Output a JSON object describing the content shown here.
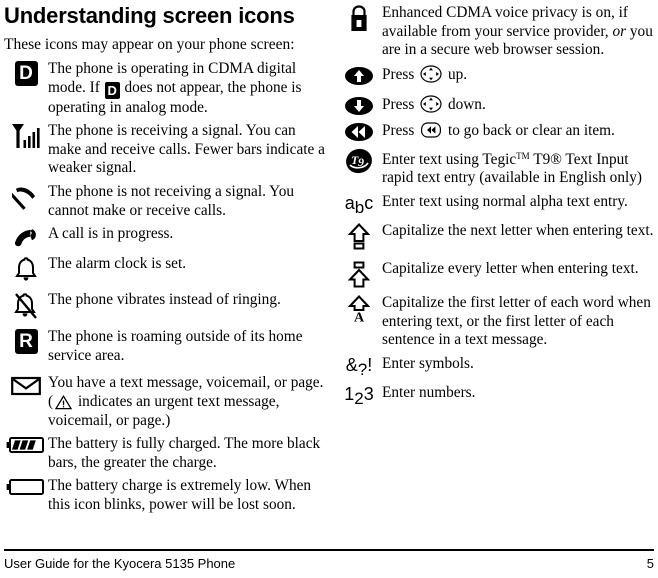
{
  "page": {
    "title": "Understanding screen icons",
    "intro": "These icons may appear on your phone screen:"
  },
  "footer": {
    "text": "User Guide for the Kyocera 5135 Phone",
    "page_number": "5"
  },
  "left_column": [
    {
      "icon": "cdma-digital-mode-icon",
      "icon_label": "D",
      "desc_pre": "The phone is operating in CDMA digital mode. If",
      "inline_badge": "D",
      "desc_post": "does not appear, the phone is operating in analog mode."
    },
    {
      "icon": "signal-strength-icon",
      "desc": "The phone is receiving a signal. You can make and receive calls. Fewer bars indicate a weaker signal."
    },
    {
      "icon": "no-signal-icon",
      "desc": "The phone is not receiving a signal. You cannot make or receive calls."
    },
    {
      "icon": "call-in-progress-icon",
      "desc": "A call is in progress."
    },
    {
      "icon": "alarm-clock-icon",
      "desc": "The alarm clock is set."
    },
    {
      "icon": "vibrate-icon",
      "desc": "The phone vibrates instead of ringing."
    },
    {
      "icon": "roaming-icon",
      "icon_label": "R",
      "desc": "The phone is roaming outside of its home service area."
    },
    {
      "icon": "message-envelope-icon",
      "desc_pre": "You have a text message, voicemail, or page. (",
      "inline_icon": "urgent-warning-triangle-icon",
      "desc_post": "indicates an urgent text message, voicemail, or page.)"
    },
    {
      "icon": "battery-full-icon",
      "desc": "The battery is fully charged. The more black bars, the greater the charge."
    },
    {
      "icon": "battery-low-icon",
      "desc": "The battery charge is extremely low. When this icon blinks, power will be lost soon."
    }
  ],
  "right_column": [
    {
      "icon": "padlock-icon",
      "desc_pre": "Enhanced CDMA voice privacy is on, if available from your service provider,",
      "desc_italic": "or",
      "desc_post": "you are in a secure web browser session."
    },
    {
      "icon": "arrow-up-oval-icon",
      "desc_pre": "Press",
      "inline_icon": "navigation-key-icon",
      "desc_post": "up."
    },
    {
      "icon": "arrow-down-oval-icon",
      "desc_pre": "Press",
      "inline_icon": "navigation-key-icon",
      "desc_post": "down."
    },
    {
      "icon": "arrow-back-oval-icon",
      "desc_pre": "Press",
      "inline_icon": "back-clear-key-icon",
      "desc_post": "to go back or clear an item."
    },
    {
      "icon": "t9-text-input-icon",
      "desc_pre": "Enter text using Tegic",
      "tm1": "TM",
      "desc_mid": "T9",
      "tm2": "®",
      "desc_post": "Text Input rapid text entry (available in English only)"
    },
    {
      "icon": "alpha-text-entry-icon",
      "icon_label": "abc",
      "desc": "Enter text using normal alpha text entry."
    },
    {
      "icon": "shift-next-letter-icon",
      "desc": "Capitalize the next letter when entering text."
    },
    {
      "icon": "caps-lock-icon",
      "desc": "Capitalize every letter when entering text."
    },
    {
      "icon": "shift-sentence-case-icon",
      "desc": "Capitalize the first letter of each word when entering text, or the first letter of each sentence in a text message."
    },
    {
      "icon": "symbols-entry-icon",
      "icon_label": "&?!",
      "desc": "Enter symbols."
    },
    {
      "icon": "numbers-entry-icon",
      "icon_label": "123",
      "desc": "Enter numbers."
    }
  ]
}
